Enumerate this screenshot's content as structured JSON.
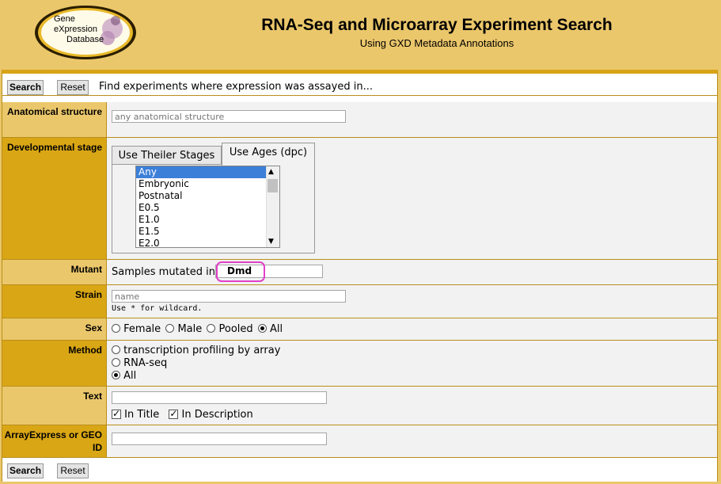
{
  "header": {
    "logo_line1": "Gene",
    "logo_line2": "eXpression",
    "logo_line3": "Database",
    "title": "RNA-Seq and Microarray Experiment Search",
    "subtitle": "Using GXD Metadata Annotations"
  },
  "top_bar": {
    "search_label": "Search",
    "reset_label": "Reset",
    "intro": "Find experiments where expression was assayed in..."
  },
  "anatomy": {
    "label": "Anatomical structure",
    "placeholder": "any anatomical structure"
  },
  "stage": {
    "label": "Developmental stage",
    "tab_theiler": "Use Theiler Stages",
    "tab_ages": "Use Ages (dpc)",
    "options": [
      "Any",
      "Embryonic",
      "Postnatal",
      "E0.5",
      "E1.0",
      "E1.5",
      "E2.0"
    ],
    "selected": "Any"
  },
  "mutant": {
    "label": "Mutant",
    "prompt": "Samples mutated in",
    "value": "Dmd",
    "highlight_color": "#e040c8"
  },
  "strain": {
    "label": "Strain",
    "placeholder": "name",
    "hint": "Use * for wildcard."
  },
  "sex": {
    "label": "Sex",
    "options": [
      "Female",
      "Male",
      "Pooled",
      "All"
    ],
    "selected": "All"
  },
  "method": {
    "label": "Method",
    "options": [
      "transcription profiling by array",
      "RNA-seq",
      "All"
    ],
    "selected": "All"
  },
  "text_search": {
    "label": "Text",
    "in_title": "In Title",
    "in_description": "In Description",
    "in_title_checked": true,
    "in_description_checked": true
  },
  "accession": {
    "label": "ArrayExpress or GEO ID"
  },
  "bottom_bar": {
    "search_label": "Search",
    "reset_label": "Reset"
  },
  "colors": {
    "label_bg": "#ebc76b",
    "label_bg_dark": "#d9a615",
    "selection_blue": "#3c7fd8"
  }
}
